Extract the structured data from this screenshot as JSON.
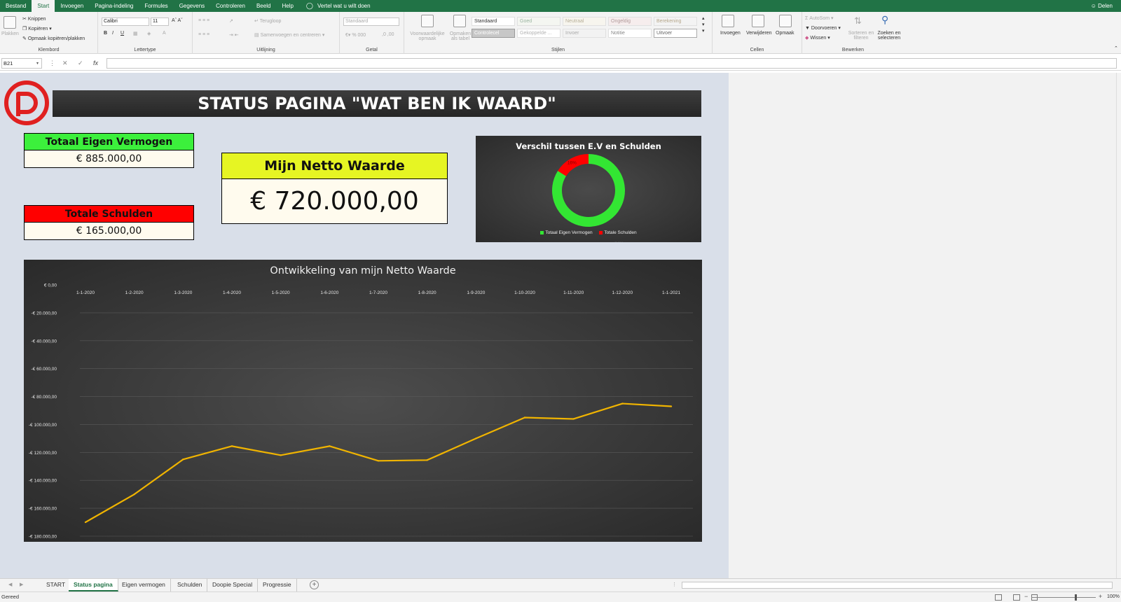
{
  "menu": {
    "items": [
      "Bestand",
      "Start",
      "Invoegen",
      "Pagina-indeling",
      "Formules",
      "Gegevens",
      "Controleren",
      "Beeld",
      "Help"
    ],
    "active_index": 1,
    "tell_me": "Vertel wat u wilt doen",
    "share": "Delen"
  },
  "ribbon": {
    "clipboard": {
      "paste": "Plakken",
      "cut": "Knippen",
      "copy": "Kopiëren",
      "format_painter": "Opmaak kopiëren/plakken",
      "label": "Klembord"
    },
    "font": {
      "name": "Calibri",
      "size": "11",
      "label": "Lettertype"
    },
    "alignment": {
      "wrap": "Terugloop",
      "merge": "Samenvoegen en centreren",
      "label": "Uitlijning"
    },
    "number": {
      "format": "Standaard",
      "label": "Getal"
    },
    "styles": {
      "conditional": "Voorwaardelijke opmaak",
      "as_table": "Opmaken als tabel",
      "cells": [
        "Standaard",
        "Goed",
        "Neutraal",
        "Ongeldig",
        "Berekening",
        "Controlecel",
        "Gekoppelde ...",
        "Invoer",
        "Notitie",
        "Uitvoer"
      ],
      "label": "Stijlen"
    },
    "cells": {
      "insert": "Invoegen",
      "delete": "Verwijderen",
      "format": "Opmaak",
      "label": "Cellen"
    },
    "editing": {
      "autosum": "AutoSom",
      "fill": "Doorvoeren",
      "clear": "Wissen",
      "sort": "Sorteren en filteren",
      "find": "Zoeken en selecteren",
      "label": "Bewerken"
    }
  },
  "formula_bar": {
    "name_box": "B21",
    "fx": "fx",
    "value": ""
  },
  "dashboard": {
    "title": "STATUS PAGINA \"WAT BEN IK WAARD\"",
    "kpi_assets": {
      "label": "Totaal Eigen Vermogen",
      "value": "€ 885.000,00",
      "color": "#3cf03c"
    },
    "kpi_debts": {
      "label": "Totale Schulden",
      "value": "€ 165.000,00",
      "color": "#ff0000"
    },
    "kpi_net": {
      "label": "Mijn Netto Waarde",
      "value": "€ 720.000,00",
      "color": "#e6f523"
    }
  },
  "chart_data": [
    {
      "type": "pie",
      "title": "Verschil tussen E.V en Schulden",
      "categories": [
        "Totaal Eigen Vermogen",
        "Totale Schulden"
      ],
      "values": [
        84,
        16
      ],
      "data_labels": [
        "84%",
        "16%"
      ],
      "colors": [
        "#33e633",
        "#ff0000"
      ],
      "legend": "bottom",
      "donut": true
    },
    {
      "type": "line",
      "title": "Ontwikkeling van mijn Netto Waarde",
      "x": [
        "1-1-2020",
        "1-2-2020",
        "1-3-2020",
        "1-4-2020",
        "1-5-2020",
        "1-6-2020",
        "1-7-2020",
        "1-8-2020",
        "1-9-2020",
        "1-10-2020",
        "1-11-2020",
        "1-12-2020",
        "1-1-2021"
      ],
      "series": [
        {
          "values": [
            -170000,
            -150000,
            -125000,
            -115500,
            -122000,
            -115500,
            -126000,
            -125500,
            -110000,
            -95000,
            -96000,
            -85000,
            -87000
          ],
          "color": "#f0b400"
        }
      ],
      "y_ticks": [
        "€ 0,00",
        "-€ 20.000,00",
        "-€ 40.000,00",
        "-€ 60.000,00",
        "-€ 80.000,00",
        "-€ 100.000,00",
        "-€ 120.000,00",
        "-€ 140.000,00",
        "-€ 160.000,00",
        "-€ 180.000,00"
      ],
      "ylim": [
        -180000,
        0
      ],
      "x_axis_position": "top",
      "grid": true
    }
  ],
  "sheet_tabs": [
    "START",
    "Status pagina",
    "Eigen vermogen",
    "Schulden",
    "Doopie Special",
    "Progressie"
  ],
  "active_tab": 1,
  "status": {
    "text": "Gereed",
    "zoom": "100%"
  }
}
